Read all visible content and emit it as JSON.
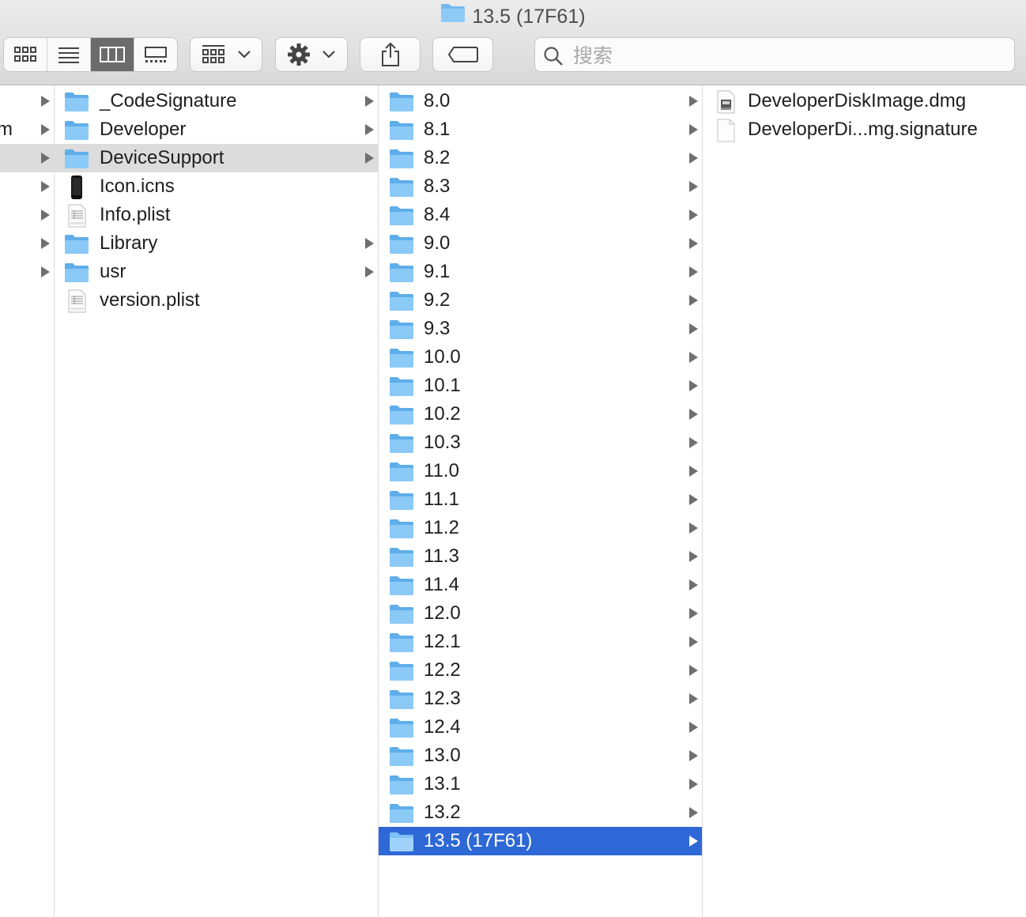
{
  "window": {
    "title": "13.5 (17F61)"
  },
  "toolbar": {
    "view_modes": [
      "icon-view",
      "list-view",
      "column-view",
      "gallery-view"
    ],
    "active_view": "column-view",
    "group_button": "group-by",
    "action_button": "action-gear",
    "share_button": "share",
    "tags_button": "tags",
    "search_placeholder": "搜索"
  },
  "columns": {
    "col1": {
      "visible_label": "m",
      "rows": [
        {
          "has_arrow": true
        },
        {
          "has_arrow": true,
          "label": "m"
        },
        {
          "has_arrow": true,
          "selected": true
        },
        {
          "has_arrow": true
        },
        {
          "has_arrow": true
        },
        {
          "has_arrow": true
        },
        {
          "has_arrow": true
        }
      ]
    },
    "col2": {
      "items": [
        {
          "label": "_CodeSignature",
          "icon": "folder-icon",
          "arrow": true
        },
        {
          "label": "Developer",
          "icon": "folder-icon",
          "arrow": true
        },
        {
          "label": "DeviceSupport",
          "icon": "folder-icon",
          "arrow": true,
          "selected": "gray"
        },
        {
          "label": "Icon.icns",
          "icon": "iphone-icon",
          "arrow": false
        },
        {
          "label": "Info.plist",
          "icon": "plist-icon",
          "arrow": false
        },
        {
          "label": "Library",
          "icon": "folder-icon",
          "arrow": true
        },
        {
          "label": "usr",
          "icon": "folder-icon",
          "arrow": true
        },
        {
          "label": "version.plist",
          "icon": "plist-icon",
          "arrow": false
        }
      ]
    },
    "col3": {
      "items": [
        {
          "label": "8.0"
        },
        {
          "label": "8.1"
        },
        {
          "label": "8.2"
        },
        {
          "label": "8.3"
        },
        {
          "label": "8.4"
        },
        {
          "label": "9.0"
        },
        {
          "label": "9.1"
        },
        {
          "label": "9.2"
        },
        {
          "label": "9.3"
        },
        {
          "label": "10.0"
        },
        {
          "label": "10.1"
        },
        {
          "label": "10.2"
        },
        {
          "label": "10.3"
        },
        {
          "label": "11.0"
        },
        {
          "label": "11.1"
        },
        {
          "label": "11.2"
        },
        {
          "label": "11.3"
        },
        {
          "label": "11.4"
        },
        {
          "label": "12.0"
        },
        {
          "label": "12.1"
        },
        {
          "label": "12.2"
        },
        {
          "label": "12.3"
        },
        {
          "label": "12.4"
        },
        {
          "label": "13.0"
        },
        {
          "label": "13.1"
        },
        {
          "label": "13.2"
        },
        {
          "label": "13.5 (17F61)",
          "selected": "blue"
        }
      ]
    },
    "col4": {
      "items": [
        {
          "label": "DeveloperDiskImage.dmg",
          "icon": "dmg-icon"
        },
        {
          "label": "DeveloperDi...mg.signature",
          "icon": "document-icon"
        }
      ]
    }
  },
  "colors": {
    "selection_blue": "#2e68d6",
    "selection_gray": "#dcdcdc",
    "folder": "#74b9ef"
  }
}
